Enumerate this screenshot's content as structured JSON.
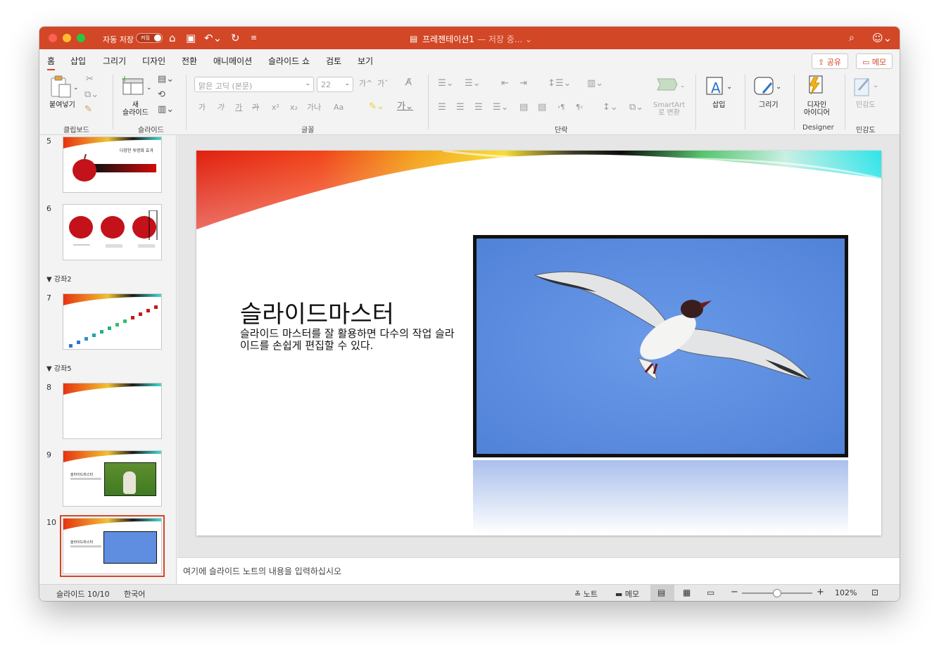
{
  "window": {
    "autosave_label": "자동 저장",
    "autosave_state": "켜짐",
    "doc_title": "프레젠테이션1",
    "doc_status": "— 저장 중... ⌄"
  },
  "tabs": [
    "홈",
    "삽입",
    "그리기",
    "디자인",
    "전환",
    "애니메이션",
    "슬라이드 쇼",
    "검토",
    "보기"
  ],
  "top_buttons": {
    "share": "공유",
    "comment": "메모"
  },
  "ribbon": {
    "paste": "붙여넣기",
    "new_slide": "새\n슬라이드",
    "clipboard_group": "클립보드",
    "slides_group": "슬라이드",
    "font_group": "글꼴",
    "paragraph_group": "단락",
    "designer_group": "Designer",
    "sensitivity_group": "민감도",
    "font_name": "맑은 고딕 (본문)",
    "font_size": "22",
    "format_letters": [
      "가",
      "가",
      "가",
      "가",
      "x²",
      "x₂",
      "가나",
      "Aa"
    ],
    "smartart": "SmartArt\n로 변환",
    "insert": "삽입",
    "draw": "그리기",
    "design_ideas": "디자인\n아이디어",
    "sensitivity": "민감도"
  },
  "thumbnails": {
    "slides": [
      {
        "num": "5",
        "title": "다양한 투명화 효과"
      },
      {
        "num": "6"
      },
      {
        "num": "7"
      },
      {
        "num": "8"
      },
      {
        "num": "9",
        "title": "슬라이드마스터"
      },
      {
        "num": "10",
        "title": "슬라이드마스터"
      }
    ],
    "sections": [
      "강좌2",
      "강좌5"
    ]
  },
  "slide": {
    "title": "슬라이드마스터",
    "body": "슬라이드 마스터를 잘 활용하면 다수의 작업 슬라이드를 손쉽게 편집할 수 있다."
  },
  "notes": {
    "placeholder": "여기에 슬라이드 노트의 내용을 입력하십시오"
  },
  "status": {
    "slide_count": "슬라이드 10/10",
    "language": "한국어",
    "notes": "노트",
    "comments": "메모",
    "zoom": "102%"
  },
  "colors": {
    "accent": "#d24726",
    "title_bar": "#d24726"
  }
}
